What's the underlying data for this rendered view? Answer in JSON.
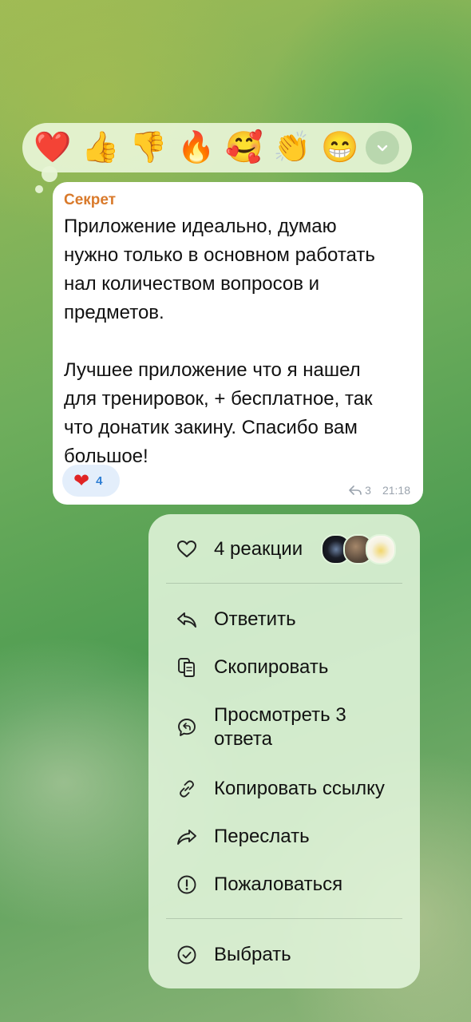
{
  "reaction_bar": {
    "emojis": [
      "❤️",
      "👍",
      "👎",
      "🔥",
      "🥰",
      "👏",
      "😁"
    ]
  },
  "message": {
    "author": "Секрет",
    "paragraph1": [
      "Приложение идеально, думаю",
      "нужно только в основном работать",
      "нал количеством вопросов и",
      "предметов."
    ],
    "paragraph2": [
      "Лучшее приложение что я нашел",
      "для тренировок, + бесплатное, так",
      "что донатик закину. Спасибо вам",
      "большое!"
    ],
    "reaction": {
      "emoji": "❤",
      "count": "4"
    },
    "replies_count": "3",
    "time": "21:18"
  },
  "menu": {
    "reactions_label": "4 реакции",
    "items": [
      {
        "label": "Ответить",
        "icon": "reply-icon"
      },
      {
        "label": "Скопировать",
        "icon": "copy-icon"
      },
      {
        "label_line1": "Просмотреть 3",
        "label_line2": "ответа",
        "icon": "thread-icon"
      },
      {
        "label": "Копировать ссылку",
        "icon": "link-icon"
      },
      {
        "label": "Переслать",
        "icon": "forward-icon"
      },
      {
        "label": "Пожаловаться",
        "icon": "report-icon"
      },
      {
        "label": "Выбрать",
        "icon": "select-icon"
      }
    ]
  },
  "colors": {
    "author": "#d97a2b",
    "reaction_count": "#2f7fd4"
  }
}
